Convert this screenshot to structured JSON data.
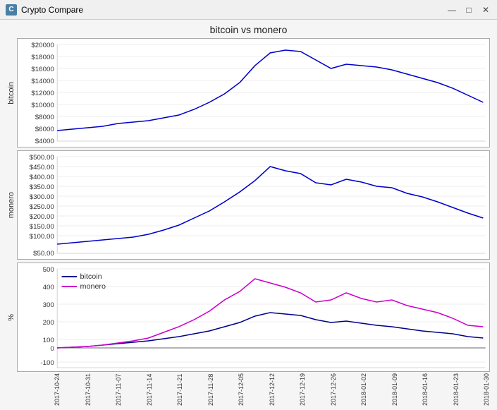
{
  "app": {
    "title": "Crypto Compare",
    "icon_label": "C"
  },
  "window_controls": {
    "minimize": "—",
    "maximize": "□",
    "close": "✕"
  },
  "chart": {
    "title": "bitcoin vs monero",
    "x_labels": [
      "2017-10-24",
      "2017-10-31",
      "2017-11-07",
      "2017-11-14",
      "2017-11-21",
      "2017-11-28",
      "2017-12-05",
      "2017-12-12",
      "2017-12-19",
      "2017-12-26",
      "2018-01-02",
      "2018-01-09",
      "2018-01-16",
      "2018-01-23",
      "2018-01-30"
    ],
    "bitcoin_y_labels": [
      "$20000",
      "$18000",
      "$16000",
      "$14000",
      "$12000",
      "$10000",
      "$8000",
      "$6000",
      "$4000"
    ],
    "monero_y_labels": [
      "$500.00",
      "$450.00",
      "$400.00",
      "$350.00",
      "$300.00",
      "$250.00",
      "$200.00",
      "$150.00",
      "$100.00",
      "$50.00"
    ],
    "pct_y_labels": [
      "500",
      "400",
      "300",
      "200",
      "100",
      "0",
      "-100"
    ],
    "y_axis_bitcoin": "bitcoin",
    "y_axis_monero": "monero",
    "y_axis_pct": "%",
    "legend_bitcoin": "bitcoin",
    "legend_monero": "monero"
  }
}
